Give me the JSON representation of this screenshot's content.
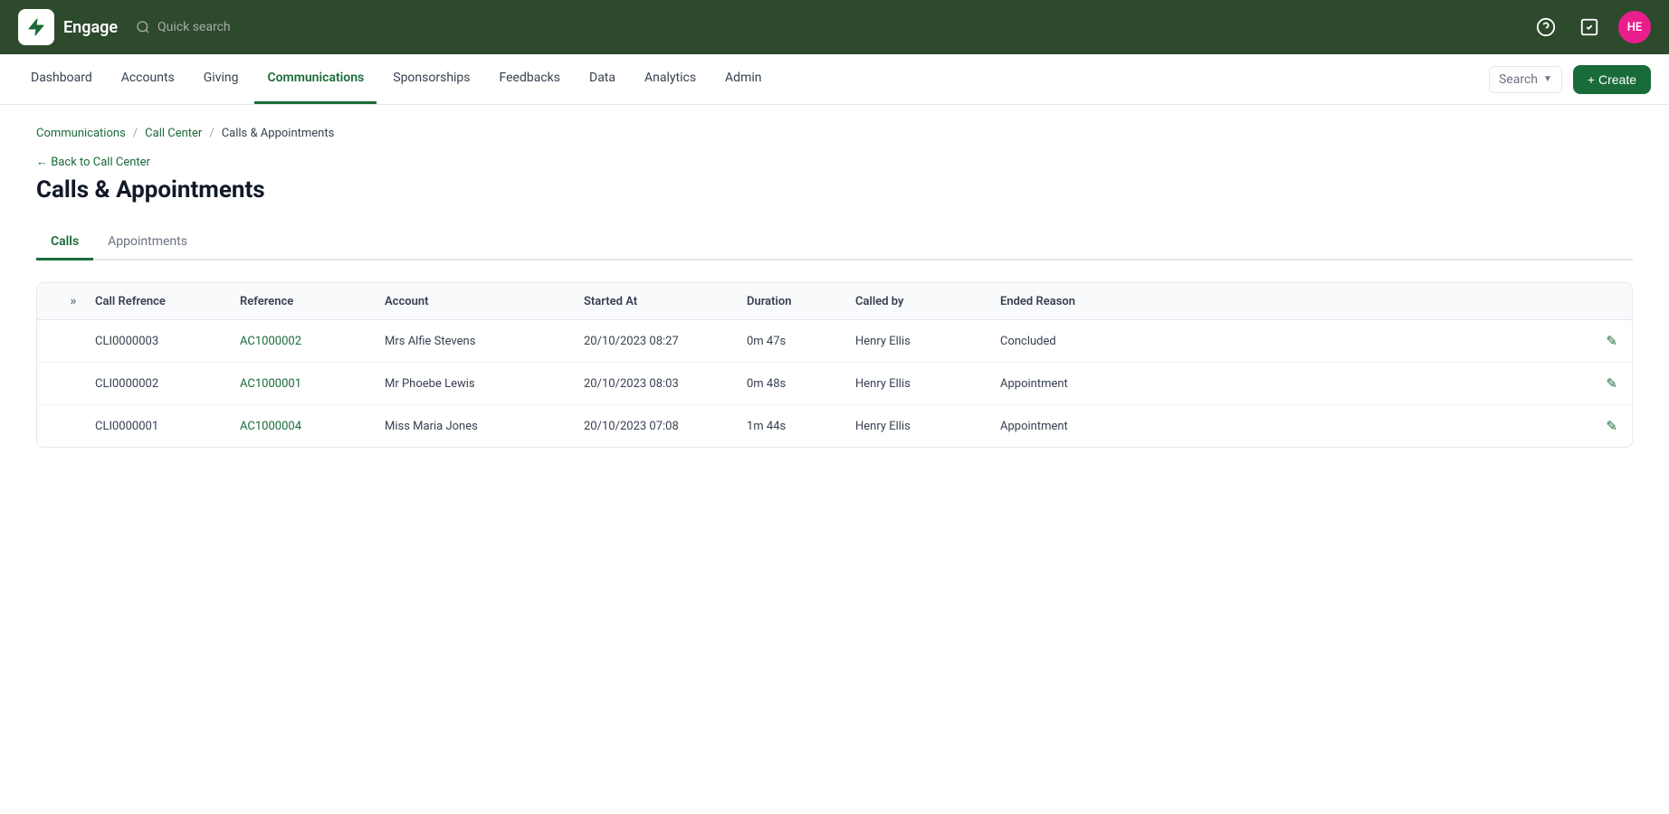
{
  "app": {
    "name": "Engage",
    "logo_alt": "Engage logo"
  },
  "topbar": {
    "quick_search_placeholder": "Quick search",
    "avatar_initials": "HE",
    "help_icon": "?",
    "tasks_icon": "✓"
  },
  "nav": {
    "items": [
      {
        "id": "dashboard",
        "label": "Dashboard",
        "active": false
      },
      {
        "id": "accounts",
        "label": "Accounts",
        "active": false
      },
      {
        "id": "giving",
        "label": "Giving",
        "active": false
      },
      {
        "id": "communications",
        "label": "Communications",
        "active": true
      },
      {
        "id": "sponsorships",
        "label": "Sponsorships",
        "active": false
      },
      {
        "id": "feedbacks",
        "label": "Feedbacks",
        "active": false
      },
      {
        "id": "data",
        "label": "Data",
        "active": false
      },
      {
        "id": "analytics",
        "label": "Analytics",
        "active": false
      },
      {
        "id": "admin",
        "label": "Admin",
        "active": false
      }
    ],
    "search_label": "Search",
    "create_label": "+ Create"
  },
  "breadcrumb": {
    "items": [
      {
        "label": "Communications",
        "link": true
      },
      {
        "label": "Call Center",
        "link": true
      },
      {
        "label": "Calls & Appointments",
        "link": false
      }
    ]
  },
  "back_link": "← Back to Call Center",
  "page_title": "Calls & Appointments",
  "tabs": [
    {
      "id": "calls",
      "label": "Calls",
      "active": true
    },
    {
      "id": "appointments",
      "label": "Appointments",
      "active": false
    }
  ],
  "table": {
    "columns": {
      "call_reference": "Call Refrence",
      "reference": "Reference",
      "account": "Account",
      "started_at": "Started At",
      "duration": "Duration",
      "called_by": "Called by",
      "ended_reason": "Ended Reason"
    },
    "rows": [
      {
        "call_reference": "CLI0000003",
        "reference": "AC1000002",
        "account": "Mrs Alfie Stevens",
        "started_at": "20/10/2023 08:27",
        "duration": "0m 47s",
        "called_by": "Henry Ellis",
        "ended_reason": "Concluded"
      },
      {
        "call_reference": "CLI0000002",
        "reference": "AC1000001",
        "account": "Mr Phoebe Lewis",
        "started_at": "20/10/2023 08:03",
        "duration": "0m 48s",
        "called_by": "Henry Ellis",
        "ended_reason": "Appointment"
      },
      {
        "call_reference": "CLI0000001",
        "reference": "AC1000004",
        "account": "Miss Maria Jones",
        "started_at": "20/10/2023 07:08",
        "duration": "1m 44s",
        "called_by": "Henry Ellis",
        "ended_reason": "Appointment"
      }
    ]
  }
}
